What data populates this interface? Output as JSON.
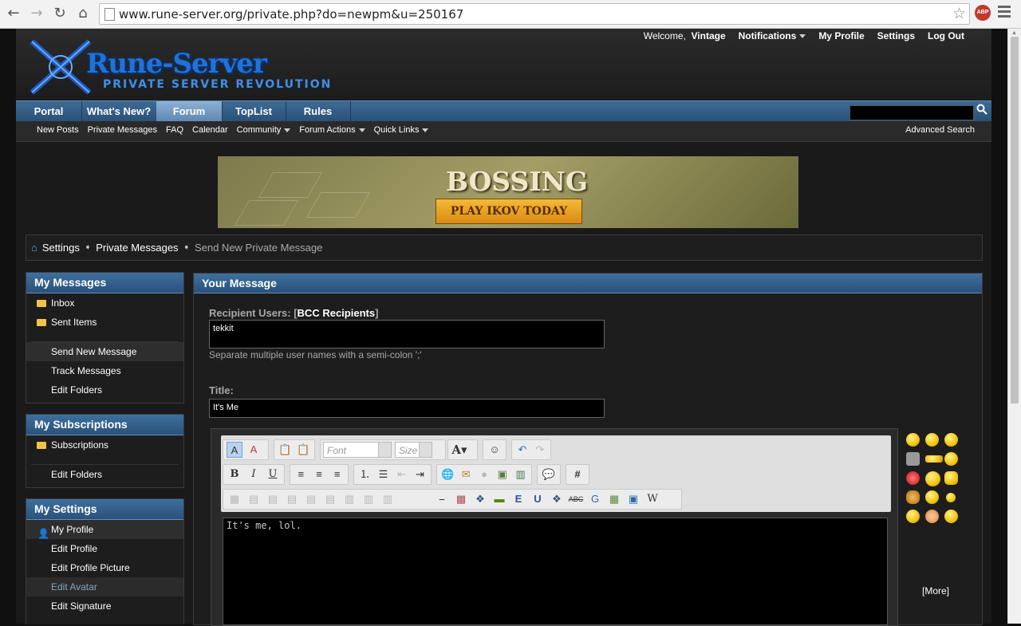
{
  "browser": {
    "url": "www.rune-server.org/private.php?do=newpm&u=250167",
    "ext_badge": "ABP"
  },
  "site": {
    "logo_name": "Rune-Server",
    "logo_tagline": "PRIVATE SERVER REVOLUTION",
    "welcome": "Welcome,",
    "username": "Vintage",
    "toplinks": [
      "Notifications",
      "My Profile",
      "Settings",
      "Log Out"
    ]
  },
  "nav": {
    "tabs": [
      "Portal",
      "What's New?",
      "Forum",
      "TopList",
      "Rules"
    ],
    "active_tab": "Forum",
    "subnav": [
      "New Posts",
      "Private Messages",
      "FAQ",
      "Calendar",
      "Community",
      "Forum Actions",
      "Quick Links"
    ],
    "advanced_search": "Advanced Search"
  },
  "banner": {
    "title": "BOSSING",
    "button": "PLAY IKOV TODAY"
  },
  "breadcrumb": [
    "Settings",
    "Private Messages",
    "Send New Private Message"
  ],
  "sidebar": {
    "messages": {
      "title": "My Messages",
      "items": [
        "Inbox",
        "Sent Items",
        "Send New Message",
        "Track Messages",
        "Edit Folders"
      ]
    },
    "subscriptions": {
      "title": "My Subscriptions",
      "items": [
        "Subscriptions",
        "Edit Folders"
      ]
    },
    "settings": {
      "title": "My Settings",
      "items": [
        "My Profile",
        "Edit Profile",
        "Edit Profile Picture",
        "Edit Avatar",
        "Edit Signature"
      ]
    }
  },
  "message": {
    "title": "Your Message",
    "recipients_label": "Recipient Users:",
    "bcc_label": "BCC Recipients",
    "recipients_value": "tekkit",
    "recipients_hint": "Separate multiple user names with a semi-colon ';'",
    "title_label": "Title:",
    "title_value": "It's Me",
    "body": "It's me, lol.",
    "font_placeholder": "Font",
    "size_placeholder": "Size",
    "more_smilies": "[More]"
  },
  "colors": {
    "nav_blue": "#2a4f74",
    "header_blue": "#3e6f9e",
    "page_bg": "#101010"
  }
}
